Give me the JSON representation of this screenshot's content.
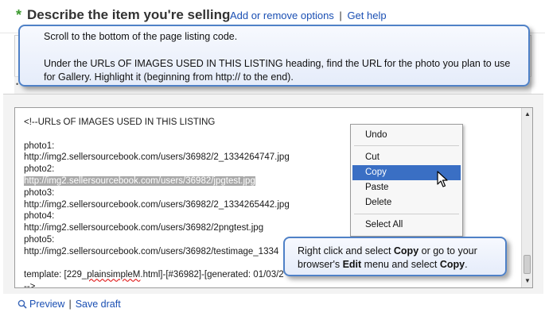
{
  "header": {
    "required_star": "*",
    "title": "Describe the item you're selling",
    "links": [
      "Add or remove options",
      "Get help"
    ],
    "separator": "|"
  },
  "tip_top": {
    "line1": "Scroll to the bottom of the page listing code.",
    "line2": "Under the URLs OF IMAGES USED IN THIS LISTING heading, find the URL for the photo you plan to use for Gallery. Highlight it (beginning from http:// to the end)."
  },
  "editor": {
    "lines": [
      "<!--URLs OF IMAGES USED IN THIS LISTING",
      "",
      "photo1:",
      "http://img2.sellersourcebook.com/users/36982/2_1334264747.jpg",
      "photo2:",
      "http://img2.sellersourcebook.com/users/36982/jpgtest.jpg",
      "photo3:",
      "http://img2.sellersourcebook.com/users/36982/2_1334265442.jpg",
      "photo4:",
      "http://img2.sellersourcebook.com/users/36982/2pngtest.jpg",
      "photo5:",
      "http://img2.sellersourcebook.com/users/36982/testimage_1334",
      "",
      "template: [229_plainsimpleM.html]-[#36982]-[generated: 01/03/2",
      "-->"
    ],
    "highlighted_index": 5,
    "template_prefix": "template: [229_",
    "template_err": "plainsimpleM",
    "template_suffix": ".html]-[#36982]-[generated: 01/03/2"
  },
  "context_menu": {
    "items": [
      "Undo",
      "Cut",
      "Copy",
      "Paste",
      "Delete",
      "Select All"
    ],
    "active": "Copy"
  },
  "tip_bottom": {
    "part1": "Right click and select ",
    "bold1": "Copy",
    "part2": " or go to your browser's ",
    "bold2": "Edit",
    "part3": " menu and select ",
    "bold3": "Copy",
    "part4": "."
  },
  "footer": {
    "preview_icon": "magnifier-icon",
    "preview_label": "Preview",
    "separator": "|",
    "save_draft_label": "Save draft"
  },
  "colors": {
    "link": "#1a4fb3",
    "required": "#3c9a30",
    "menu_active": "#3a6fc4",
    "callout_border": "#4f81c7"
  }
}
